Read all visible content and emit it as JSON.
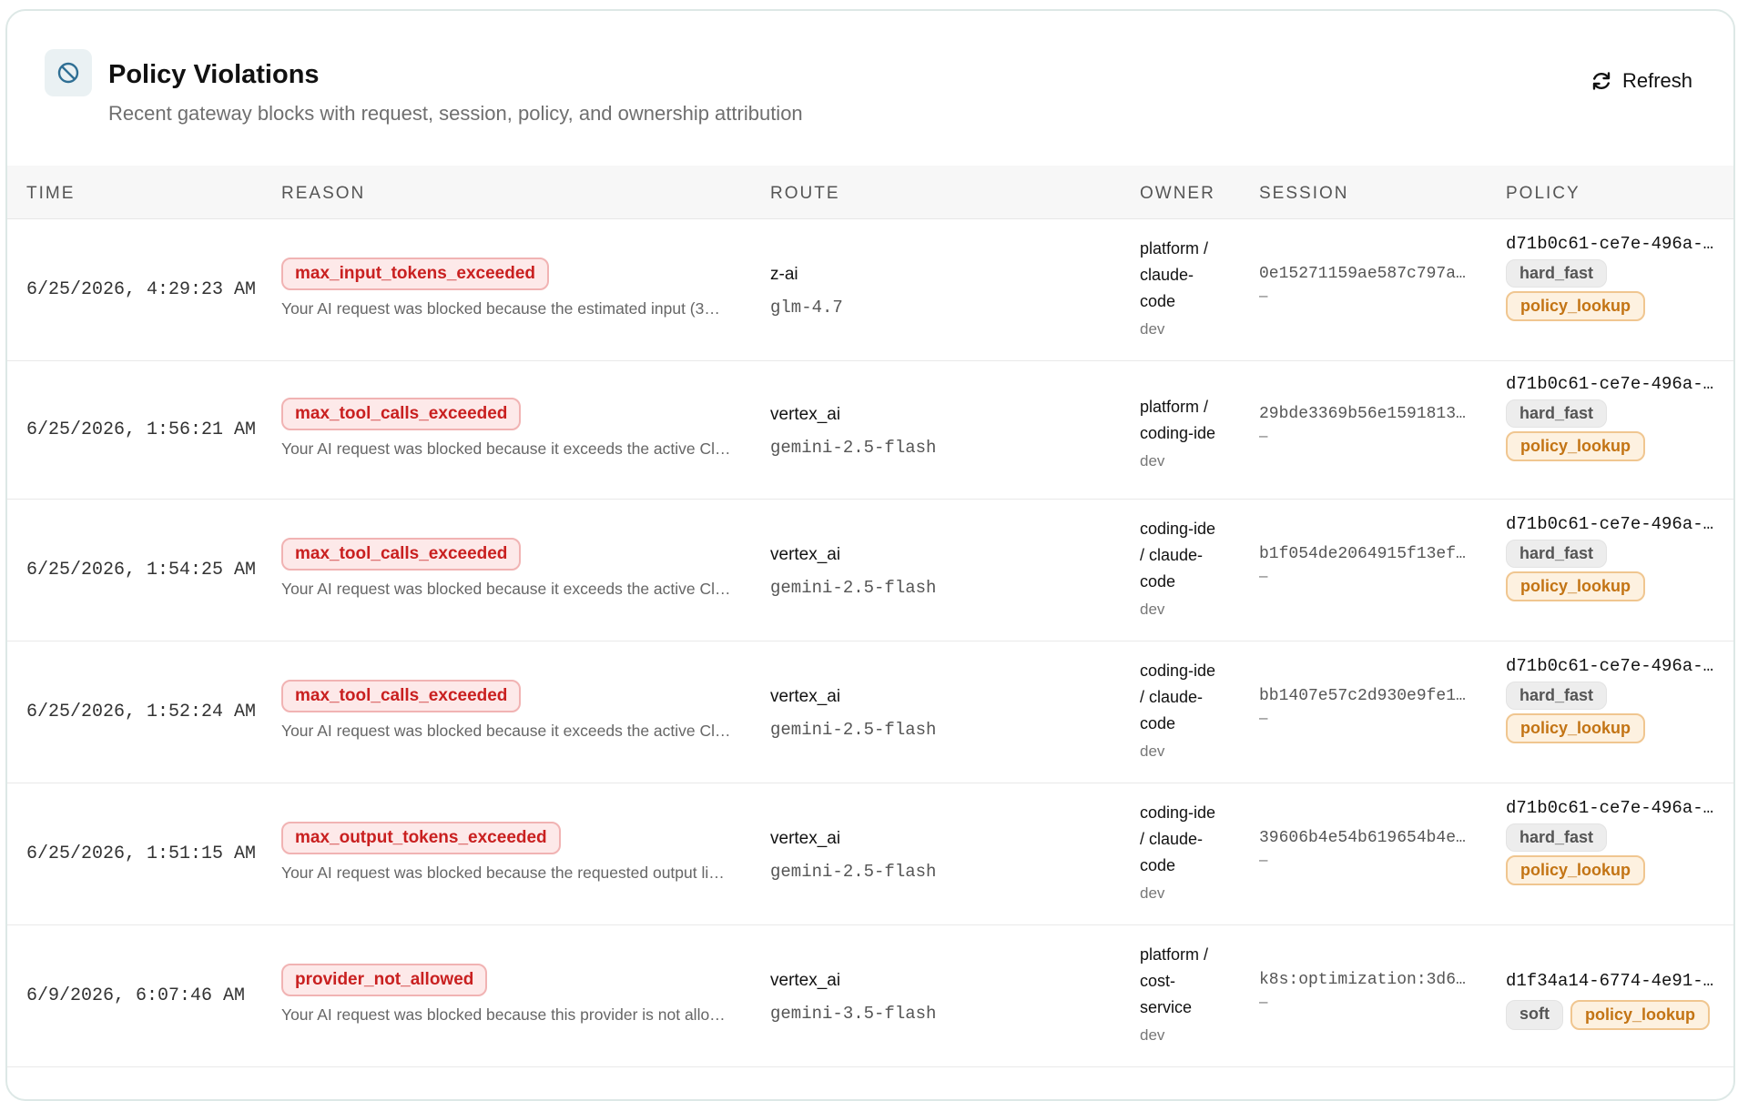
{
  "header": {
    "icon": "blocked-icon",
    "title": "Policy Violations",
    "subtitle": "Recent gateway blocks with request, session, policy, and ownership attribution",
    "refresh_label": "Refresh",
    "refresh_icon": "refresh-icon"
  },
  "table": {
    "columns": {
      "time": "TIME",
      "reason": "REASON",
      "route": "ROUTE",
      "owner": "OWNER",
      "session": "SESSION",
      "policy": "POLICY"
    },
    "rows": [
      {
        "time": "6/25/2026, 4:29:23 AM",
        "reason": "max_input_tokens_exceeded",
        "message": "Your AI request was blocked because the estimated input (3…",
        "provider": "z-ai",
        "model": "glm-4.7",
        "owner_lines": [
          "platform /",
          "claude-",
          "code"
        ],
        "env": "dev",
        "session": "0e15271159ae587c797a…",
        "session_sub": "–",
        "policy_id": "d71b0c61-ce7e-496a-8…",
        "mode": "hard_fast",
        "lookup": "policy_lookup"
      },
      {
        "time": "6/25/2026, 1:56:21 AM",
        "reason": "max_tool_calls_exceeded",
        "message": "Your AI request was blocked because it exceeds the active Cl…",
        "provider": "vertex_ai",
        "model": "gemini-2.5-flash",
        "owner_lines": [
          "platform /",
          "coding-ide"
        ],
        "env": "dev",
        "session": "29bde3369b56e1591813…",
        "session_sub": "–",
        "policy_id": "d71b0c61-ce7e-496a-8…",
        "mode": "hard_fast",
        "lookup": "policy_lookup"
      },
      {
        "time": "6/25/2026, 1:54:25 AM",
        "reason": "max_tool_calls_exceeded",
        "message": "Your AI request was blocked because it exceeds the active Cl…",
        "provider": "vertex_ai",
        "model": "gemini-2.5-flash",
        "owner_lines": [
          "coding-ide",
          "/ claude-",
          "code"
        ],
        "env": "dev",
        "session": "b1f054de2064915f13ef…",
        "session_sub": "–",
        "policy_id": "d71b0c61-ce7e-496a-8…",
        "mode": "hard_fast",
        "lookup": "policy_lookup"
      },
      {
        "time": "6/25/2026, 1:52:24 AM",
        "reason": "max_tool_calls_exceeded",
        "message": "Your AI request was blocked because it exceeds the active Cl…",
        "provider": "vertex_ai",
        "model": "gemini-2.5-flash",
        "owner_lines": [
          "coding-ide",
          "/ claude-",
          "code"
        ],
        "env": "dev",
        "session": "bb1407e57c2d930e9fe1…",
        "session_sub": "–",
        "policy_id": "d71b0c61-ce7e-496a-8…",
        "mode": "hard_fast",
        "lookup": "policy_lookup"
      },
      {
        "time": "6/25/2026, 1:51:15 AM",
        "reason": "max_output_tokens_exceeded",
        "message": "Your AI request was blocked because the requested output li…",
        "provider": "vertex_ai",
        "model": "gemini-2.5-flash",
        "owner_lines": [
          "coding-ide",
          "/ claude-",
          "code"
        ],
        "env": "dev",
        "session": "39606b4e54b619654b4e…",
        "session_sub": "–",
        "policy_id": "d71b0c61-ce7e-496a-8…",
        "mode": "hard_fast",
        "lookup": "policy_lookup"
      },
      {
        "time": "6/9/2026, 6:07:46 AM",
        "reason": "provider_not_allowed",
        "message": "Your AI request was blocked because this provider is not allo…",
        "provider": "vertex_ai",
        "model": "gemini-3.5-flash",
        "owner_lines": [
          "platform /",
          "cost-",
          "service"
        ],
        "env": "dev",
        "session": "k8s:optimization:3d6…",
        "session_sub": "–",
        "policy_id": "d1f34a14-6774-4e91-a…",
        "mode": "soft",
        "lookup": "policy_lookup"
      }
    ]
  },
  "colors": {
    "reason_badge_bg": "#fde9e9",
    "reason_badge_text": "#c92020",
    "lookup_tag_bg": "#fdf1e0",
    "lookup_tag_text": "#c37414",
    "mode_tag_bg": "#ededed"
  }
}
